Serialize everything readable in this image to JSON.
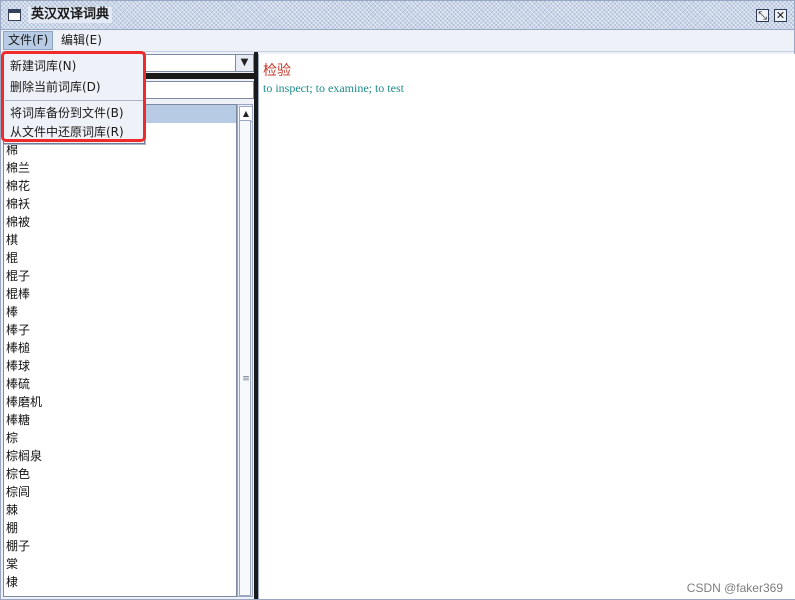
{
  "window": {
    "title": "英汉双译词典"
  },
  "menubar": [
    {
      "label": "文件(F)"
    },
    {
      "label": "编辑(E)"
    }
  ],
  "file_menu": [
    {
      "label": "新建词库(N)"
    },
    {
      "label": "删除当前词库(D)"
    },
    {
      "label": "将词库备份到文件(B)"
    },
    {
      "label": "从文件中还原词库(R)"
    }
  ],
  "words": [
    {
      "text": ""
    },
    {
      "text": ""
    },
    {
      "text": "棉"
    },
    {
      "text": "棉兰"
    },
    {
      "text": "棉花"
    },
    {
      "text": "棉袄"
    },
    {
      "text": "棉被"
    },
    {
      "text": "棋"
    },
    {
      "text": "棍"
    },
    {
      "text": "棍子"
    },
    {
      "text": "棍棒"
    },
    {
      "text": "棒"
    },
    {
      "text": "棒子"
    },
    {
      "text": "棒槌"
    },
    {
      "text": "棒球"
    },
    {
      "text": "棒硫"
    },
    {
      "text": "棒磨机"
    },
    {
      "text": "棒糖"
    },
    {
      "text": "棕"
    },
    {
      "text": "棕榈泉"
    },
    {
      "text": "棕色"
    },
    {
      "text": "棕闾"
    },
    {
      "text": "棘"
    },
    {
      "text": "棚"
    },
    {
      "text": "棚子"
    },
    {
      "text": "棠"
    },
    {
      "text": "棣"
    }
  ],
  "detail": {
    "word": "检验",
    "meaning": "to inspect; to examine; to test"
  },
  "watermark": "CSDN @faker369",
  "colors": {
    "highlight": "#ee2a2a",
    "selection": "#b8cbe4",
    "word": "#c0392b",
    "meaning": "#1f8a8a"
  }
}
